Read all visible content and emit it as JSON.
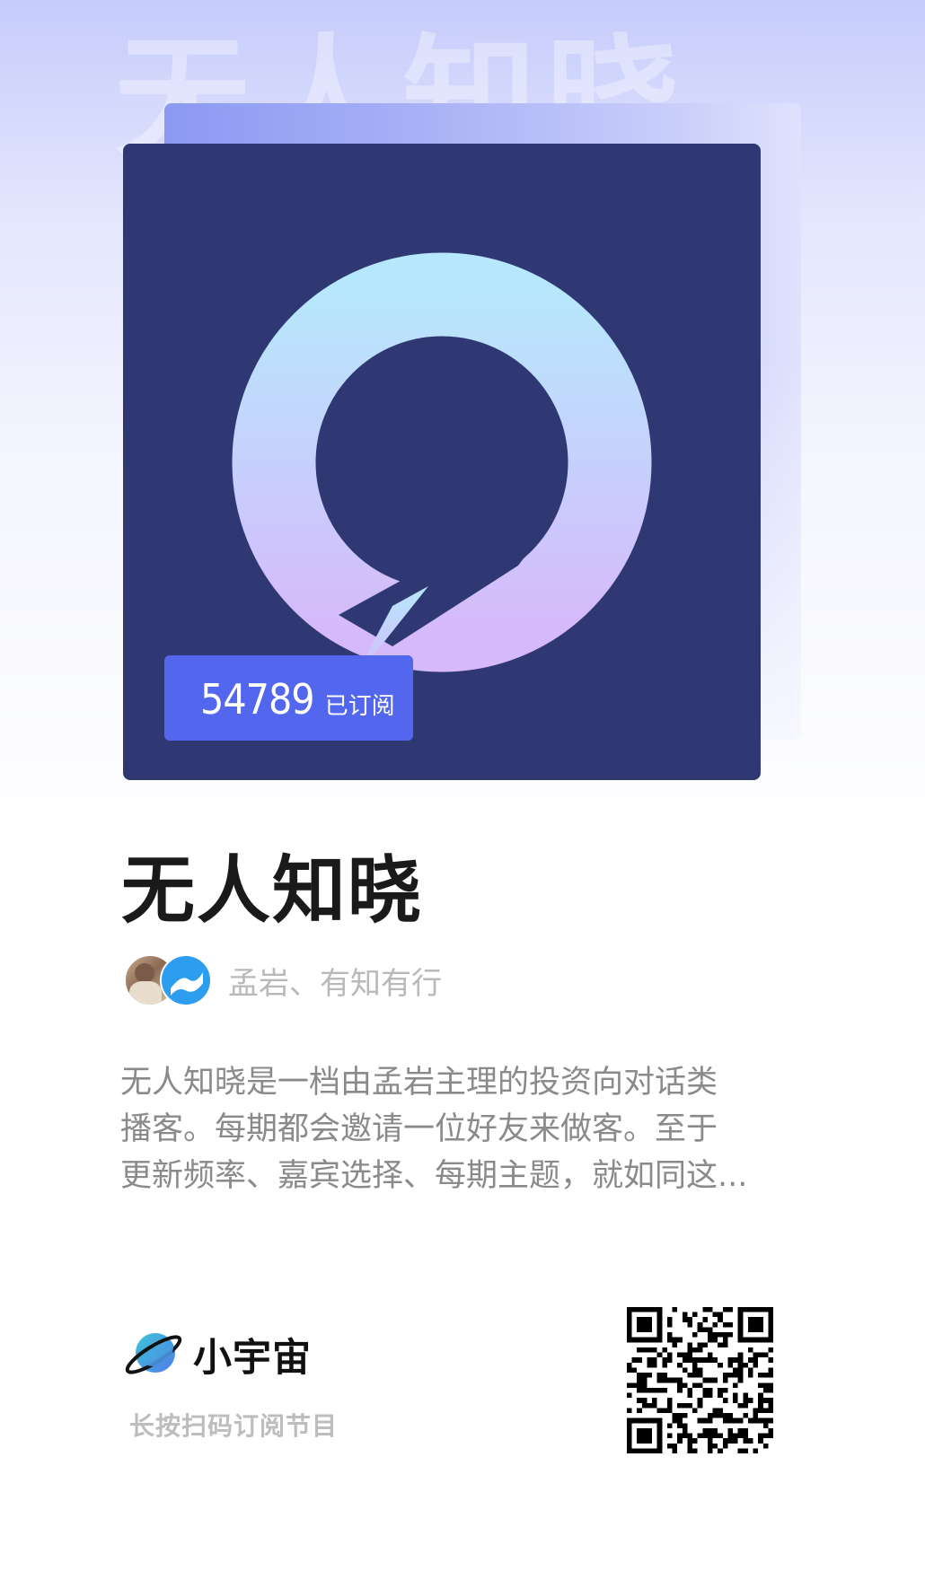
{
  "background": {
    "watermark": "无人知晓"
  },
  "cover": {
    "colors": {
      "background": "#303873",
      "ring_top": "#b7e7fd",
      "ring_bottom": "#d6b9fb",
      "back_card": "#8c99f2"
    }
  },
  "subscription": {
    "count": "54789",
    "label": "已订阅",
    "color": "#5266ee"
  },
  "podcast": {
    "title": "无人知晓",
    "hosts": "孟岩、有知有行",
    "description_lines": [
      "无人知晓是一档由孟岩主理的投资向对话类",
      "播客。每期都会邀请一位好友来做客。至于",
      "更新频率、嘉宾选择、每期主题，就如同这..."
    ]
  },
  "footer": {
    "brand": "小宇宙",
    "scan_hint": "长按扫码订阅节目",
    "brand_icon": "planet-icon",
    "qr_icon": "qr-code-icon"
  }
}
